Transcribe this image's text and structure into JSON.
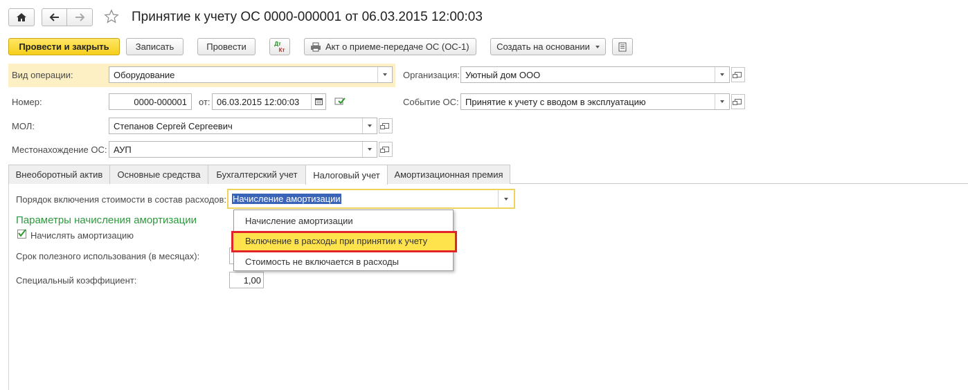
{
  "window": {
    "title": "Принятие к учету ОС 0000-000001 от 06.03.2015 12:00:03"
  },
  "toolbar": {
    "post_and_close": "Провести и закрыть",
    "save": "Записать",
    "post": "Провести",
    "dt_kt_line1": "Дт",
    "dt_kt_line2": "Кт",
    "act_print": "Акт о приеме-передаче ОС (ОС-1)",
    "create_based_on": "Создать на основании"
  },
  "form": {
    "operation_type": {
      "label": "Вид операции:",
      "value": "Оборудование"
    },
    "number": {
      "label": "Номер:",
      "value": "0000-000001"
    },
    "date": {
      "label": "от:",
      "value": "06.03.2015 12:00:03"
    },
    "mol": {
      "label": "МОЛ:",
      "value": "Степанов Сергей Сергеевич"
    },
    "location": {
      "label": "Местонахождение ОС:",
      "value": "АУП"
    },
    "organization": {
      "label": "Организация:",
      "value": "Уютный дом ООО"
    },
    "event": {
      "label": "Событие ОС:",
      "value": "Принятие к учету с вводом в эксплуатацию"
    }
  },
  "tabs": [
    {
      "label": "Внеоборотный актив"
    },
    {
      "label": "Основные средства"
    },
    {
      "label": "Бухгалтерский учет"
    },
    {
      "label": "Налоговый учет"
    },
    {
      "label": "Амортизационная премия"
    }
  ],
  "tax": {
    "expense_order_label": "Порядок включения стоимости в состав расходов:",
    "expense_order_value": "Начисление амортизации",
    "section_title": "Параметры начисления амортизации",
    "accrue_label": "Начислять амортизацию",
    "accrue_checked": true,
    "useful_life_label": "Срок полезного использования (в месяцах):",
    "coef_label": "Специальный коэффициент:",
    "coef_value": "1,00"
  },
  "dropdown": {
    "options": [
      {
        "label": "Начисление амортизации"
      },
      {
        "label": "Включение в расходы при принятии к учету"
      },
      {
        "label": "Стоимость не включается в расходы"
      }
    ],
    "highlighted_index": 1,
    "highlight_color": "#ffe34d",
    "outline_color": "#e1232a"
  },
  "colors": {
    "primary_button": "#f5cf1c",
    "section_title": "#2c9a3c",
    "focus_border": "#f0d35a"
  }
}
